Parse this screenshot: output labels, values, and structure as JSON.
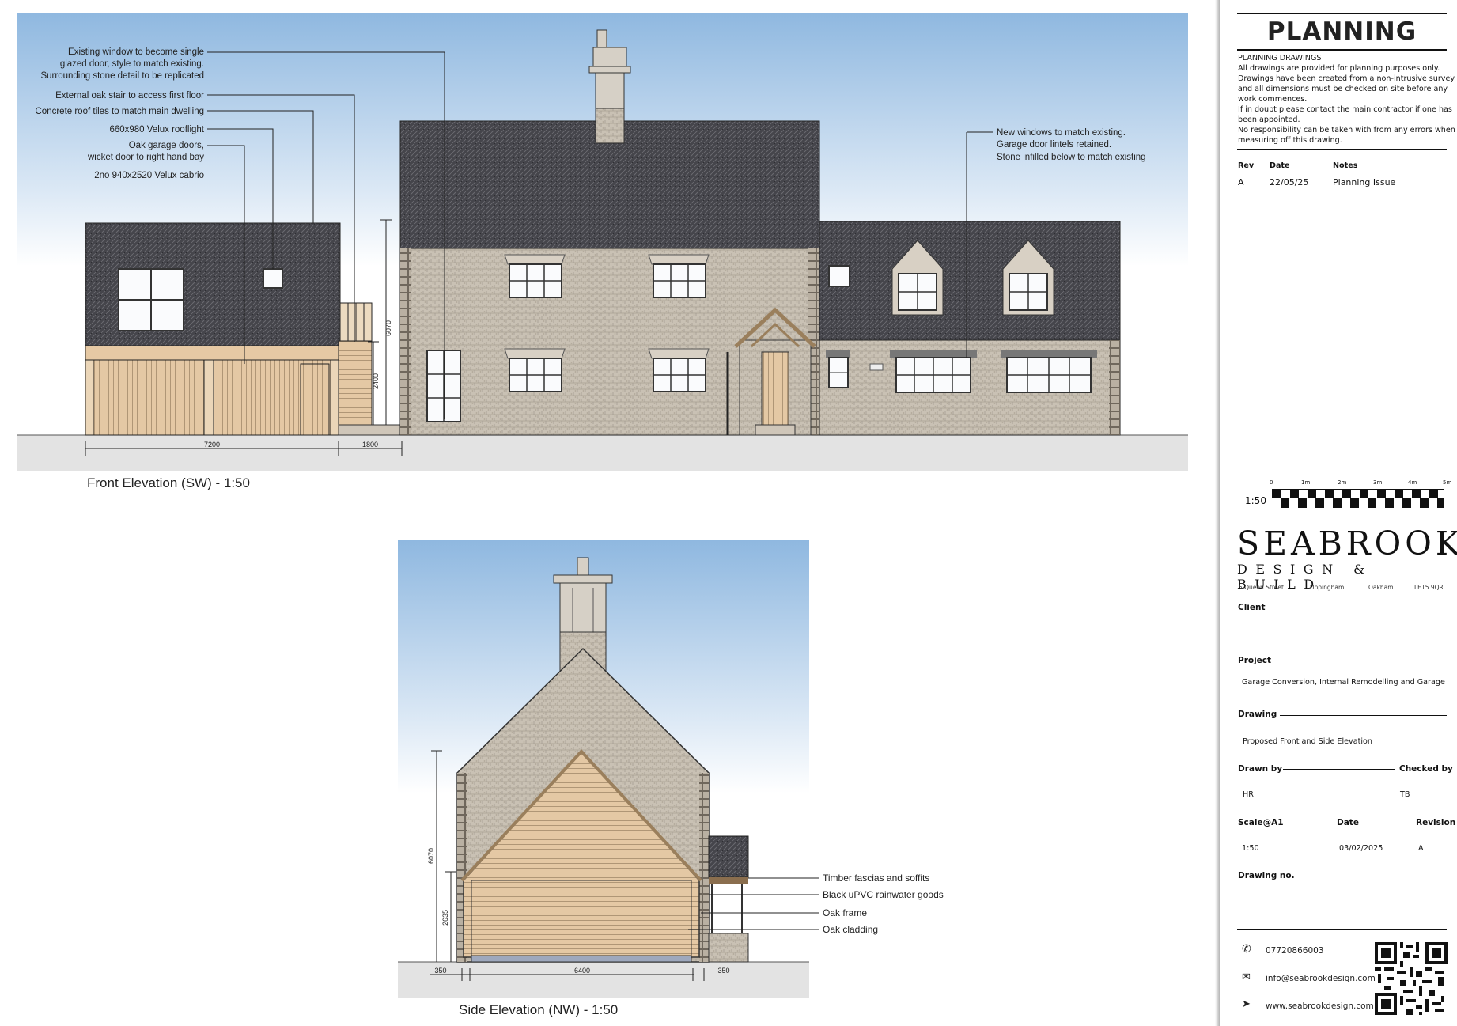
{
  "title_block": {
    "heading": "PLANNING",
    "notes_heading": "PLANNING DRAWINGS",
    "notes_lines": [
      "All drawings are provided for planning purposes only.",
      "Drawings have been created from a non-intrusive survey",
      "and all dimensions must be checked on site before any",
      "work commences.",
      "If in doubt please contact the main contractor if one has",
      "been appointed.",
      "No responsibility can be taken with from any errors when",
      "measuring off this drawing."
    ],
    "rev_headers": {
      "rev": "Rev",
      "date": "Date",
      "notes": "Notes"
    },
    "revisions": [
      {
        "rev": "A",
        "date": "22/05/25",
        "notes": "Planning Issue"
      }
    ],
    "scale_bar": {
      "label": "1:50",
      "ticks": [
        "0",
        "1m",
        "2m",
        "3m",
        "4m",
        "5m"
      ]
    },
    "company": {
      "name": "SEABROOK",
      "tagline": "DESIGN & BUILD"
    },
    "address": [
      "5 Queen Street",
      "Uppingham",
      "Oakham",
      "LE15 9QR"
    ],
    "fields": {
      "client_label": "Client",
      "project_label": "Project",
      "project_value": "Garage Conversion, Internal Remodelling and Garage",
      "drawing_label": "Drawing",
      "drawing_value": "Proposed Front and Side Elevation",
      "drawn_by_label": "Drawn by",
      "drawn_by_value": "HR",
      "checked_by_label": "Checked by",
      "checked_by_value": "TB",
      "scale_label": "Scale@A1",
      "scale_value": "1:50",
      "date_label": "Date",
      "date_value": "03/02/2025",
      "revision_label": "Revision",
      "revision_value": "A",
      "drawing_no_label": "Drawing no."
    },
    "contact": {
      "phone": "07720866003",
      "email": "info@seabrookdesign.com",
      "web": "www.seabrookdesign.com"
    }
  },
  "front_elevation": {
    "title": "Front Elevation (SW) - 1:50",
    "annotations": [
      "Existing window to become single",
      "glazed door, style to match existing.",
      "Surrounding stone detail to be replicated",
      "External oak stair to access first floor",
      "Concrete roof tiles to match main dwelling",
      "660x980 Velux rooflight",
      "Oak garage doors,",
      "wicket door to right hand bay",
      "2no 940x2520 Velux cabrio"
    ],
    "right_annotation": [
      "New windows to match existing.",
      "Garage door lintels retained.",
      "Stone infilled below to match existing"
    ],
    "dims": {
      "width_main": "7200",
      "width_stair": "1800",
      "height_total": "6070",
      "height_door": "2400"
    }
  },
  "side_elevation": {
    "title": "Side Elevation (NW) - 1:50",
    "annotations": [
      "Timber fascias and soffits",
      "Black uPVC rainwater goods",
      "Oak frame",
      "Oak cladding"
    ],
    "dims": {
      "width_left": "350",
      "width_main": "6400",
      "width_right": "350",
      "height_total": "6070",
      "height_eaves": "2635"
    }
  },
  "colors": {
    "sky": "#8fb8e0",
    "roof": "#3f3f44",
    "stone": "#c7beb0",
    "oak": "#e3c7a2",
    "ground": "#e2e2e2"
  },
  "icons": [
    "phone-icon",
    "email-icon",
    "web-icon",
    "qr-code"
  ]
}
